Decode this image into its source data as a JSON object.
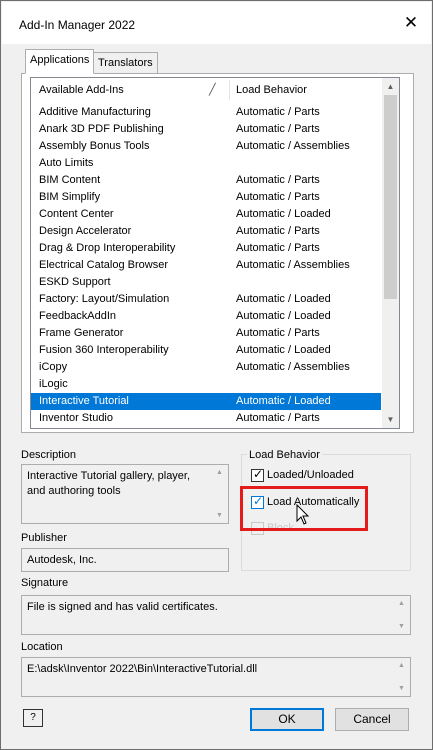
{
  "window": {
    "title": "Add-In Manager 2022",
    "close_glyph": "✕"
  },
  "tabs": [
    {
      "label": "Applications",
      "active": true
    },
    {
      "label": "Translators",
      "active": false
    }
  ],
  "list": {
    "columns": {
      "name": "Available Add-Ins",
      "sort_glyph": "╱",
      "behavior": "Load Behavior"
    },
    "rows": [
      {
        "name": "Additive Manufacturing",
        "behavior": "Automatic / Parts"
      },
      {
        "name": "Anark 3D PDF Publishing",
        "behavior": "Automatic / Parts"
      },
      {
        "name": "Assembly Bonus Tools",
        "behavior": "Automatic / Assemblies"
      },
      {
        "name": "Auto Limits",
        "behavior": ""
      },
      {
        "name": "BIM Content",
        "behavior": "Automatic / Parts"
      },
      {
        "name": "BIM Simplify",
        "behavior": "Automatic / Parts"
      },
      {
        "name": "Content Center",
        "behavior": "Automatic / Loaded"
      },
      {
        "name": "Design Accelerator",
        "behavior": "Automatic / Parts"
      },
      {
        "name": "Drag & Drop Interoperability",
        "behavior": "Automatic / Parts"
      },
      {
        "name": "Electrical Catalog Browser",
        "behavior": "Automatic / Assemblies"
      },
      {
        "name": "ESKD Support",
        "behavior": ""
      },
      {
        "name": "Factory: Layout/Simulation",
        "behavior": "Automatic / Loaded"
      },
      {
        "name": "FeedbackAddIn",
        "behavior": "Automatic / Loaded"
      },
      {
        "name": "Frame Generator",
        "behavior": "Automatic / Parts"
      },
      {
        "name": "Fusion 360 Interoperability",
        "behavior": "Automatic / Loaded"
      },
      {
        "name": "iCopy",
        "behavior": "Automatic / Assemblies"
      },
      {
        "name": "iLogic",
        "behavior": ""
      },
      {
        "name": "Interactive Tutorial",
        "behavior": "Automatic / Loaded",
        "selected": true
      },
      {
        "name": "Inventor Studio",
        "behavior": "Automatic / Parts"
      }
    ]
  },
  "description": {
    "label": "Description",
    "text": "Interactive Tutorial gallery, player, and authoring tools"
  },
  "publisher": {
    "label": "Publisher",
    "value": "Autodesk, Inc."
  },
  "signature": {
    "label": "Signature",
    "value": "File is signed and has valid certificates."
  },
  "location": {
    "label": "Location",
    "value": "E:\\adsk\\Inventor 2022\\Bin\\InteractiveTutorial.dll"
  },
  "load_behavior": {
    "label": "Load Behavior",
    "loaded_unloaded": {
      "label": "Loaded/Unloaded",
      "checked": true
    },
    "load_automatically": {
      "label": "Load Automatically",
      "checked": true
    },
    "block": {
      "label": "Block",
      "checked": false,
      "disabled": true
    }
  },
  "buttons": {
    "help": "?",
    "ok": "OK",
    "cancel": "Cancel"
  },
  "colors": {
    "selection": "#0078d7",
    "highlight_box": "#e41b1b"
  }
}
